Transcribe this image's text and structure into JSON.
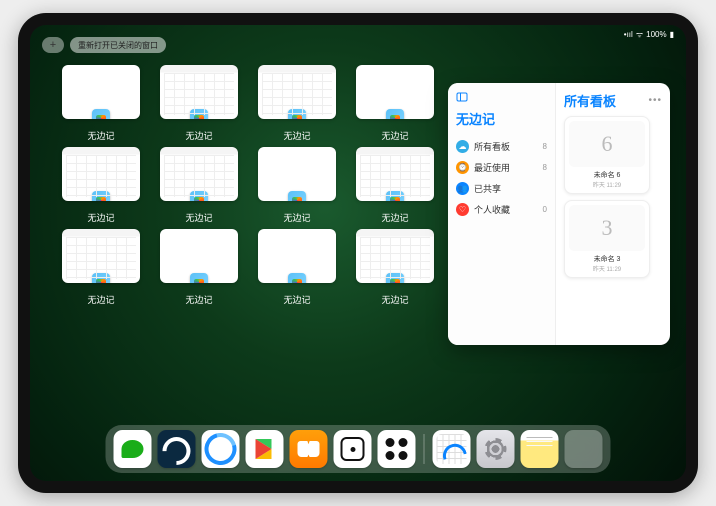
{
  "status": {
    "battery": "100%",
    "wifi": "wifi",
    "signal": "•ııl"
  },
  "top": {
    "plus": "+",
    "reopen_label": "重新打开已关闭的窗口"
  },
  "app_switcher": {
    "app_label": "无边记",
    "windows": [
      {
        "variant": "blank"
      },
      {
        "variant": "calendar"
      },
      {
        "variant": "calendar"
      },
      {
        "variant": "blank"
      },
      {
        "variant": "calendar"
      },
      {
        "variant": "calendar"
      },
      {
        "variant": "blank"
      },
      {
        "variant": "calendar"
      },
      {
        "variant": "calendar"
      },
      {
        "variant": "blank"
      },
      {
        "variant": "blank"
      },
      {
        "variant": "calendar"
      }
    ]
  },
  "popover": {
    "left_title": "无边记",
    "right_title": "所有看板",
    "menu": [
      {
        "icon_color": "#32ade6",
        "glyph": "☁",
        "label": "所有看板",
        "count": "8"
      },
      {
        "icon_color": "#ff9500",
        "glyph": "⌚",
        "label": "最近使用",
        "count": "8"
      },
      {
        "icon_color": "#0a84ff",
        "glyph": "👥",
        "label": "已共享",
        "count": ""
      },
      {
        "icon_color": "#ff3b30",
        "glyph": "♡",
        "label": "个人收藏",
        "count": "0"
      }
    ],
    "boards": [
      {
        "symbol": "6",
        "name": "未命名 6",
        "date": "昨天 11:29"
      },
      {
        "symbol": "3",
        "name": "未命名 3",
        "date": "昨天 11:29"
      }
    ]
  },
  "dock": {
    "items": [
      {
        "name": "wechat-icon",
        "cls": "di-wechat"
      },
      {
        "name": "hd-video-icon",
        "cls": "di-hd"
      },
      {
        "name": "browser-icon",
        "cls": "di-browser"
      },
      {
        "name": "play-store-icon",
        "cls": "di-play"
      },
      {
        "name": "books-icon",
        "cls": "di-books"
      },
      {
        "name": "dice-app-icon",
        "cls": "di-dice"
      },
      {
        "name": "connect-app-icon",
        "cls": "di-connect"
      }
    ],
    "right_items": [
      {
        "name": "freeform-icon",
        "cls": "di-freeform"
      },
      {
        "name": "settings-icon",
        "cls": "di-settings"
      },
      {
        "name": "notes-icon",
        "cls": "di-notes"
      }
    ]
  }
}
